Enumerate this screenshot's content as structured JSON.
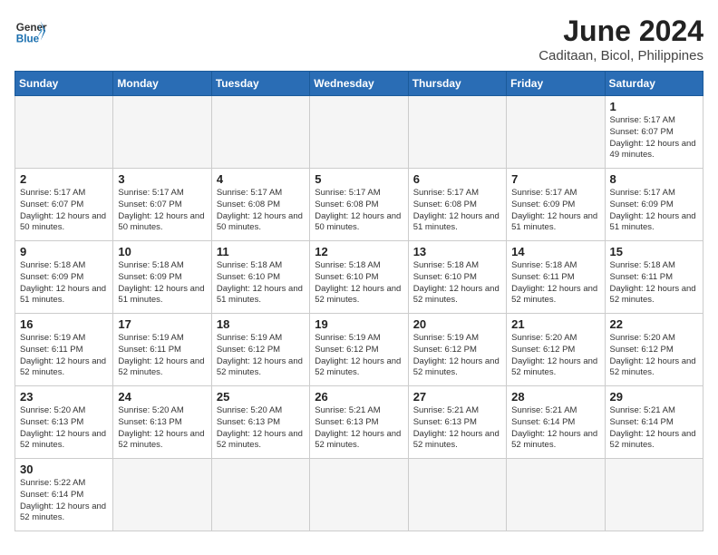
{
  "header": {
    "logo_general": "General",
    "logo_blue": "Blue",
    "title": "June 2024",
    "location": "Caditaan, Bicol, Philippines"
  },
  "days_of_week": [
    "Sunday",
    "Monday",
    "Tuesday",
    "Wednesday",
    "Thursday",
    "Friday",
    "Saturday"
  ],
  "weeks": [
    [
      {
        "day": "",
        "sunrise": "",
        "sunset": "",
        "daylight": ""
      },
      {
        "day": "",
        "sunrise": "",
        "sunset": "",
        "daylight": ""
      },
      {
        "day": "",
        "sunrise": "",
        "sunset": "",
        "daylight": ""
      },
      {
        "day": "",
        "sunrise": "",
        "sunset": "",
        "daylight": ""
      },
      {
        "day": "",
        "sunrise": "",
        "sunset": "",
        "daylight": ""
      },
      {
        "day": "",
        "sunrise": "",
        "sunset": "",
        "daylight": ""
      },
      {
        "day": "1",
        "sunrise": "Sunrise: 5:17 AM",
        "sunset": "Sunset: 6:07 PM",
        "daylight": "Daylight: 12 hours and 49 minutes."
      }
    ],
    [
      {
        "day": "2",
        "sunrise": "Sunrise: 5:17 AM",
        "sunset": "Sunset: 6:07 PM",
        "daylight": "Daylight: 12 hours and 50 minutes."
      },
      {
        "day": "3",
        "sunrise": "Sunrise: 5:17 AM",
        "sunset": "Sunset: 6:07 PM",
        "daylight": "Daylight: 12 hours and 50 minutes."
      },
      {
        "day": "4",
        "sunrise": "Sunrise: 5:17 AM",
        "sunset": "Sunset: 6:08 PM",
        "daylight": "Daylight: 12 hours and 50 minutes."
      },
      {
        "day": "5",
        "sunrise": "Sunrise: 5:17 AM",
        "sunset": "Sunset: 6:08 PM",
        "daylight": "Daylight: 12 hours and 50 minutes."
      },
      {
        "day": "6",
        "sunrise": "Sunrise: 5:17 AM",
        "sunset": "Sunset: 6:08 PM",
        "daylight": "Daylight: 12 hours and 51 minutes."
      },
      {
        "day": "7",
        "sunrise": "Sunrise: 5:17 AM",
        "sunset": "Sunset: 6:09 PM",
        "daylight": "Daylight: 12 hours and 51 minutes."
      },
      {
        "day": "8",
        "sunrise": "Sunrise: 5:17 AM",
        "sunset": "Sunset: 6:09 PM",
        "daylight": "Daylight: 12 hours and 51 minutes."
      }
    ],
    [
      {
        "day": "9",
        "sunrise": "Sunrise: 5:18 AM",
        "sunset": "Sunset: 6:09 PM",
        "daylight": "Daylight: 12 hours and 51 minutes."
      },
      {
        "day": "10",
        "sunrise": "Sunrise: 5:18 AM",
        "sunset": "Sunset: 6:09 PM",
        "daylight": "Daylight: 12 hours and 51 minutes."
      },
      {
        "day": "11",
        "sunrise": "Sunrise: 5:18 AM",
        "sunset": "Sunset: 6:10 PM",
        "daylight": "Daylight: 12 hours and 51 minutes."
      },
      {
        "day": "12",
        "sunrise": "Sunrise: 5:18 AM",
        "sunset": "Sunset: 6:10 PM",
        "daylight": "Daylight: 12 hours and 52 minutes."
      },
      {
        "day": "13",
        "sunrise": "Sunrise: 5:18 AM",
        "sunset": "Sunset: 6:10 PM",
        "daylight": "Daylight: 12 hours and 52 minutes."
      },
      {
        "day": "14",
        "sunrise": "Sunrise: 5:18 AM",
        "sunset": "Sunset: 6:11 PM",
        "daylight": "Daylight: 12 hours and 52 minutes."
      },
      {
        "day": "15",
        "sunrise": "Sunrise: 5:18 AM",
        "sunset": "Sunset: 6:11 PM",
        "daylight": "Daylight: 12 hours and 52 minutes."
      }
    ],
    [
      {
        "day": "16",
        "sunrise": "Sunrise: 5:19 AM",
        "sunset": "Sunset: 6:11 PM",
        "daylight": "Daylight: 12 hours and 52 minutes."
      },
      {
        "day": "17",
        "sunrise": "Sunrise: 5:19 AM",
        "sunset": "Sunset: 6:11 PM",
        "daylight": "Daylight: 12 hours and 52 minutes."
      },
      {
        "day": "18",
        "sunrise": "Sunrise: 5:19 AM",
        "sunset": "Sunset: 6:12 PM",
        "daylight": "Daylight: 12 hours and 52 minutes."
      },
      {
        "day": "19",
        "sunrise": "Sunrise: 5:19 AM",
        "sunset": "Sunset: 6:12 PM",
        "daylight": "Daylight: 12 hours and 52 minutes."
      },
      {
        "day": "20",
        "sunrise": "Sunrise: 5:19 AM",
        "sunset": "Sunset: 6:12 PM",
        "daylight": "Daylight: 12 hours and 52 minutes."
      },
      {
        "day": "21",
        "sunrise": "Sunrise: 5:20 AM",
        "sunset": "Sunset: 6:12 PM",
        "daylight": "Daylight: 12 hours and 52 minutes."
      },
      {
        "day": "22",
        "sunrise": "Sunrise: 5:20 AM",
        "sunset": "Sunset: 6:12 PM",
        "daylight": "Daylight: 12 hours and 52 minutes."
      }
    ],
    [
      {
        "day": "23",
        "sunrise": "Sunrise: 5:20 AM",
        "sunset": "Sunset: 6:13 PM",
        "daylight": "Daylight: 12 hours and 52 minutes."
      },
      {
        "day": "24",
        "sunrise": "Sunrise: 5:20 AM",
        "sunset": "Sunset: 6:13 PM",
        "daylight": "Daylight: 12 hours and 52 minutes."
      },
      {
        "day": "25",
        "sunrise": "Sunrise: 5:20 AM",
        "sunset": "Sunset: 6:13 PM",
        "daylight": "Daylight: 12 hours and 52 minutes."
      },
      {
        "day": "26",
        "sunrise": "Sunrise: 5:21 AM",
        "sunset": "Sunset: 6:13 PM",
        "daylight": "Daylight: 12 hours and 52 minutes."
      },
      {
        "day": "27",
        "sunrise": "Sunrise: 5:21 AM",
        "sunset": "Sunset: 6:13 PM",
        "daylight": "Daylight: 12 hours and 52 minutes."
      },
      {
        "day": "28",
        "sunrise": "Sunrise: 5:21 AM",
        "sunset": "Sunset: 6:14 PM",
        "daylight": "Daylight: 12 hours and 52 minutes."
      },
      {
        "day": "29",
        "sunrise": "Sunrise: 5:21 AM",
        "sunset": "Sunset: 6:14 PM",
        "daylight": "Daylight: 12 hours and 52 minutes."
      }
    ],
    [
      {
        "day": "30",
        "sunrise": "Sunrise: 5:22 AM",
        "sunset": "Sunset: 6:14 PM",
        "daylight": "Daylight: 12 hours and 52 minutes."
      },
      {
        "day": "",
        "sunrise": "",
        "sunset": "",
        "daylight": ""
      },
      {
        "day": "",
        "sunrise": "",
        "sunset": "",
        "daylight": ""
      },
      {
        "day": "",
        "sunrise": "",
        "sunset": "",
        "daylight": ""
      },
      {
        "day": "",
        "sunrise": "",
        "sunset": "",
        "daylight": ""
      },
      {
        "day": "",
        "sunrise": "",
        "sunset": "",
        "daylight": ""
      },
      {
        "day": "",
        "sunrise": "",
        "sunset": "",
        "daylight": ""
      }
    ]
  ]
}
